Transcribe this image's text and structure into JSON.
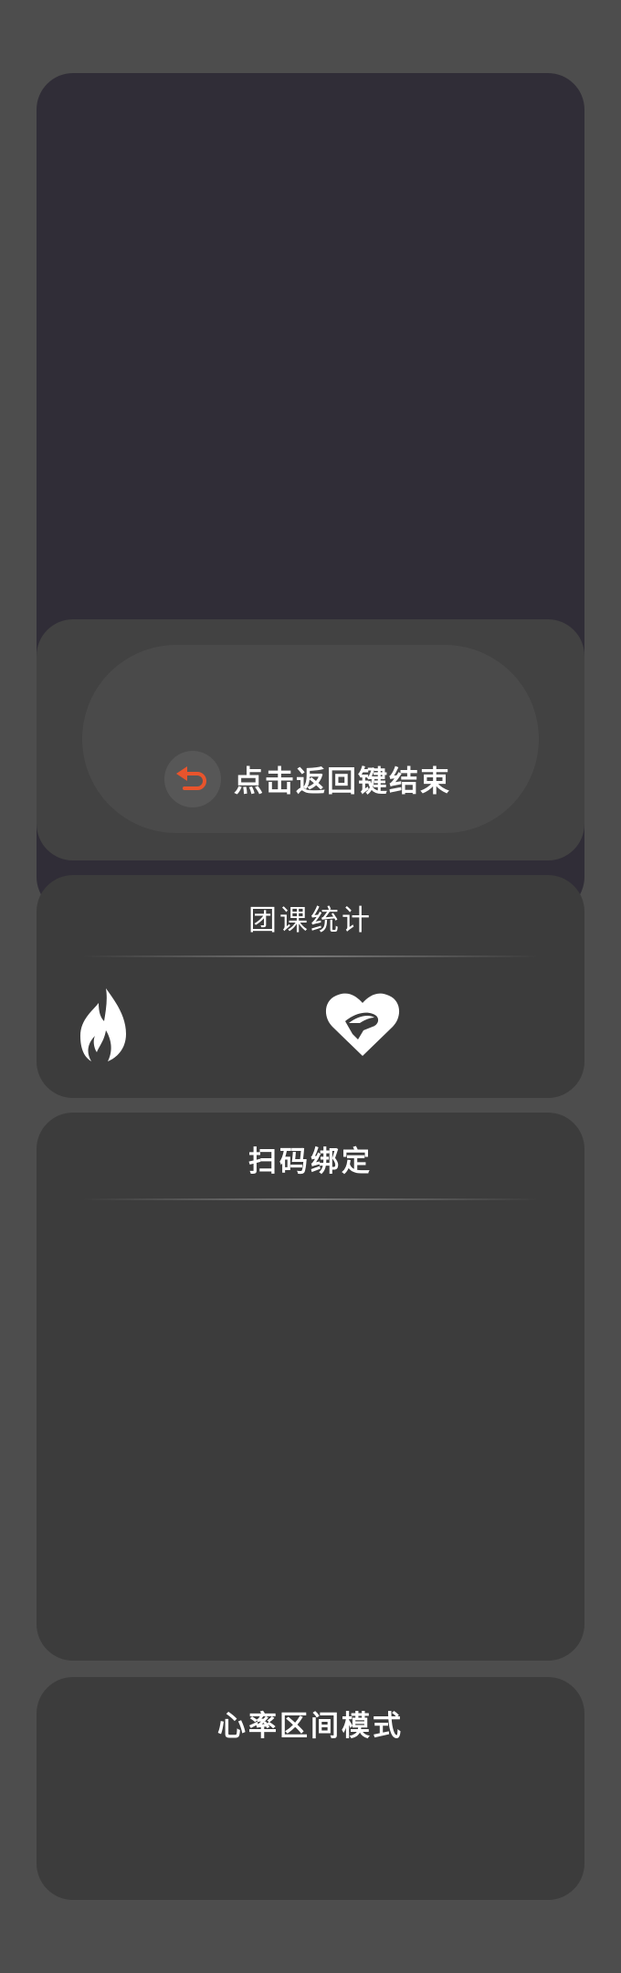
{
  "return_hint": {
    "label": "点击返回键结束",
    "icon": "return-arrow-icon",
    "icon_color": "#e8542c"
  },
  "stats": {
    "title": "团课统计",
    "icons": [
      "flame-icon",
      "heart-icon"
    ]
  },
  "scan": {
    "title": "扫码绑定"
  },
  "heart_rate": {
    "title": "心率区间模式"
  },
  "colors": {
    "background": "#4d4d4d",
    "video_panel": "#302d37",
    "card": "#3c3c3c",
    "accent": "#e8542c"
  }
}
